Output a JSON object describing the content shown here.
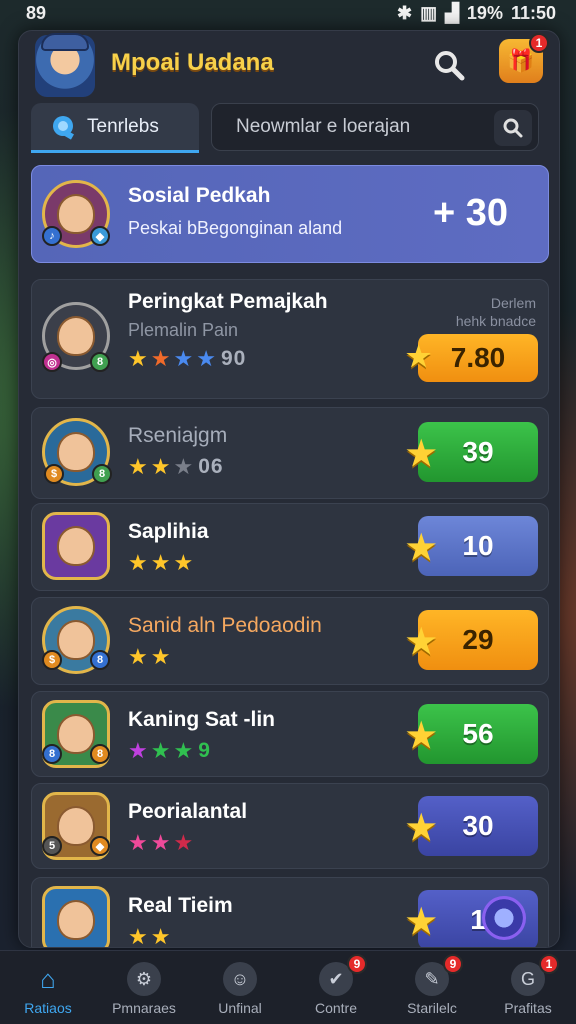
{
  "status": {
    "time_left": "89",
    "battery": "19%",
    "clock": "11:50"
  },
  "header": {
    "title": "Mpoai Uadana",
    "gift_badge": "1"
  },
  "tabs": {
    "active_label": "Tenrlebs"
  },
  "search": {
    "placeholder": "Neowmlar e loerajan"
  },
  "featured": {
    "name": "Sosial Pedkah",
    "subtitle": "Peskai bBegonginan aland",
    "score": "+ 30"
  },
  "cards": [
    {
      "name": "Peringkat Pemajkah",
      "subtitle": "Plemalin Pain",
      "stars_num": "90",
      "side_note_1": "Derlem",
      "side_note_2": "hehk bnadce",
      "score": "7.80"
    },
    {
      "name": "Rseniajgm",
      "stars_num": "06",
      "score": "39"
    },
    {
      "name": "Saplihia",
      "score": "10"
    },
    {
      "name": "Sanid aln Pedoaodin",
      "score": "29"
    },
    {
      "name": "Kaning Sat -lin",
      "stars_num": "9",
      "score": "56"
    },
    {
      "name": "Peorialantal",
      "score": "30"
    },
    {
      "name": "Real Tieim",
      "score": "1"
    }
  ],
  "nav": [
    {
      "label": "Ratiaos"
    },
    {
      "label": "Pmnaraes"
    },
    {
      "label": "Unfinal"
    },
    {
      "label": "Contre",
      "badge": "9"
    },
    {
      "label": "Starilelc",
      "badge": "9"
    },
    {
      "label": "Prafitas",
      "badge": "1"
    }
  ],
  "colors": {
    "accent": "#3fa7f0",
    "title_gold": "#f7d14a",
    "featured_bg": "#5566b8"
  }
}
